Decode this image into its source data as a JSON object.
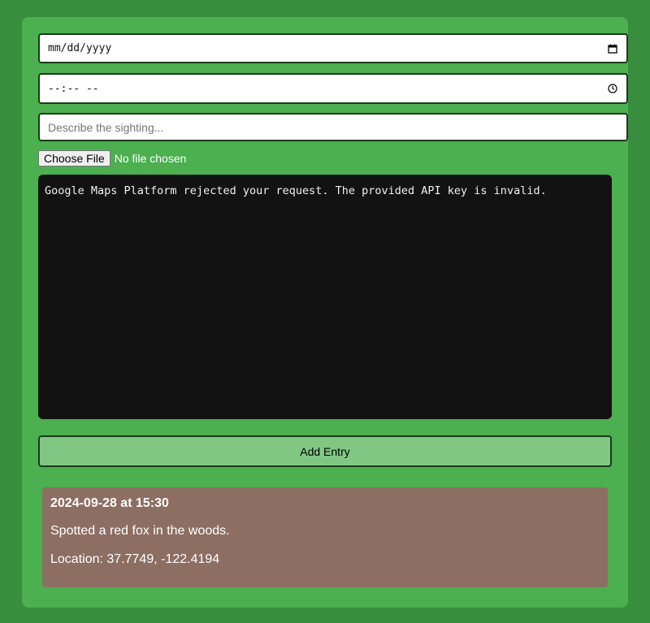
{
  "form": {
    "date_placeholder": "mm/dd/yyyy",
    "time_placeholder": "--:-- --",
    "description_placeholder": "Describe the sighting...",
    "file_button_label": "Choose File",
    "file_status": "No file chosen",
    "date_icon": "calendar-icon",
    "time_icon": "clock-icon"
  },
  "map": {
    "error_message": "Google Maps Platform rejected your request. The provided API key is invalid."
  },
  "add_button_label": "Add Entry",
  "entries": [
    {
      "timestamp": "2024-09-28 at 15:30",
      "description": "Spotted a red fox in the woods.",
      "location": "Location: 37.7749, -122.4194"
    }
  ],
  "colors": {
    "page_background": "#388e3c",
    "card_background": "#4caf50",
    "button_background": "#81c784",
    "entry_background": "#8d6e63",
    "map_background": "#121212"
  }
}
